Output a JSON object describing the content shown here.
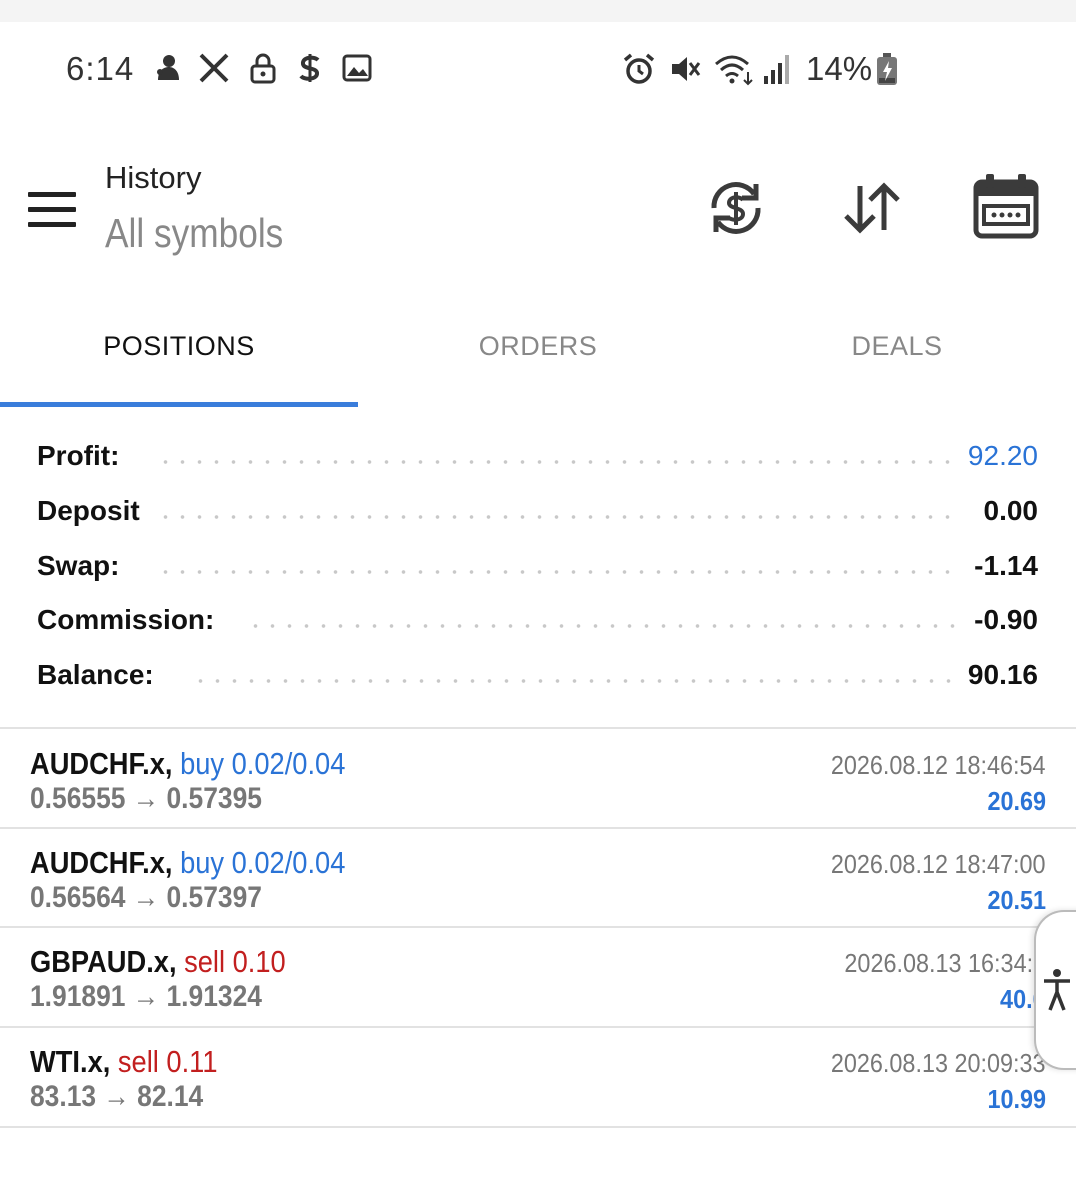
{
  "status_bar": {
    "time": "6:14",
    "left_icons": [
      "notification-app-icon",
      "x-icon",
      "lock-icon",
      "dollar-app-icon",
      "image-icon"
    ],
    "right_icons": [
      "alarm-icon",
      "vibrate-mute-icon",
      "wifi-icon",
      "signal-icon"
    ],
    "battery_percent": "14%"
  },
  "header": {
    "title": "History",
    "subtitle": "All symbols",
    "actions": [
      "currency-exchange-icon",
      "sort-icon",
      "calendar-icon"
    ]
  },
  "tabs": [
    {
      "label": "POSITIONS",
      "active": true
    },
    {
      "label": "ORDERS",
      "active": false
    },
    {
      "label": "DEALS",
      "active": false
    }
  ],
  "summary": [
    {
      "label": "Profit:",
      "value": "92.20"
    },
    {
      "label": "Deposit",
      "value": "0.00"
    },
    {
      "label": "Swap:",
      "value": "-1.14"
    },
    {
      "label": "Commission:",
      "value": "-0.90"
    },
    {
      "label": "Balance:",
      "value": "90.16"
    }
  ],
  "positions": [
    {
      "symbol": "AUDCHF.x,",
      "side": "buy 0.02/0.04",
      "prices": "0.56555 → 0.57395",
      "time": "2026.08.12 18:46:54",
      "profit": "20.69"
    },
    {
      "symbol": "AUDCHF.x,",
      "side": "buy 0.02/0.04",
      "prices": "0.56564 → 0.57397",
      "time": "2026.08.12 18:47:00",
      "profit": "20.51"
    },
    {
      "symbol": "GBPAUD.x,",
      "side": "sell 0.10",
      "prices": "1.91891 → 1.91324",
      "time": "2026.08.13 16:34:1",
      "profit": "40.0"
    },
    {
      "symbol": "WTI.x,",
      "side": "sell 0.11",
      "prices": "83.13 → 82.14",
      "time": "2026.08.13 20:09:33",
      "profit": "10.99"
    }
  ],
  "colors": {
    "accent": "#3a7ddb",
    "buy": "#2a73d6",
    "sell": "#c21f1f",
    "profit": "#2a73d6"
  }
}
